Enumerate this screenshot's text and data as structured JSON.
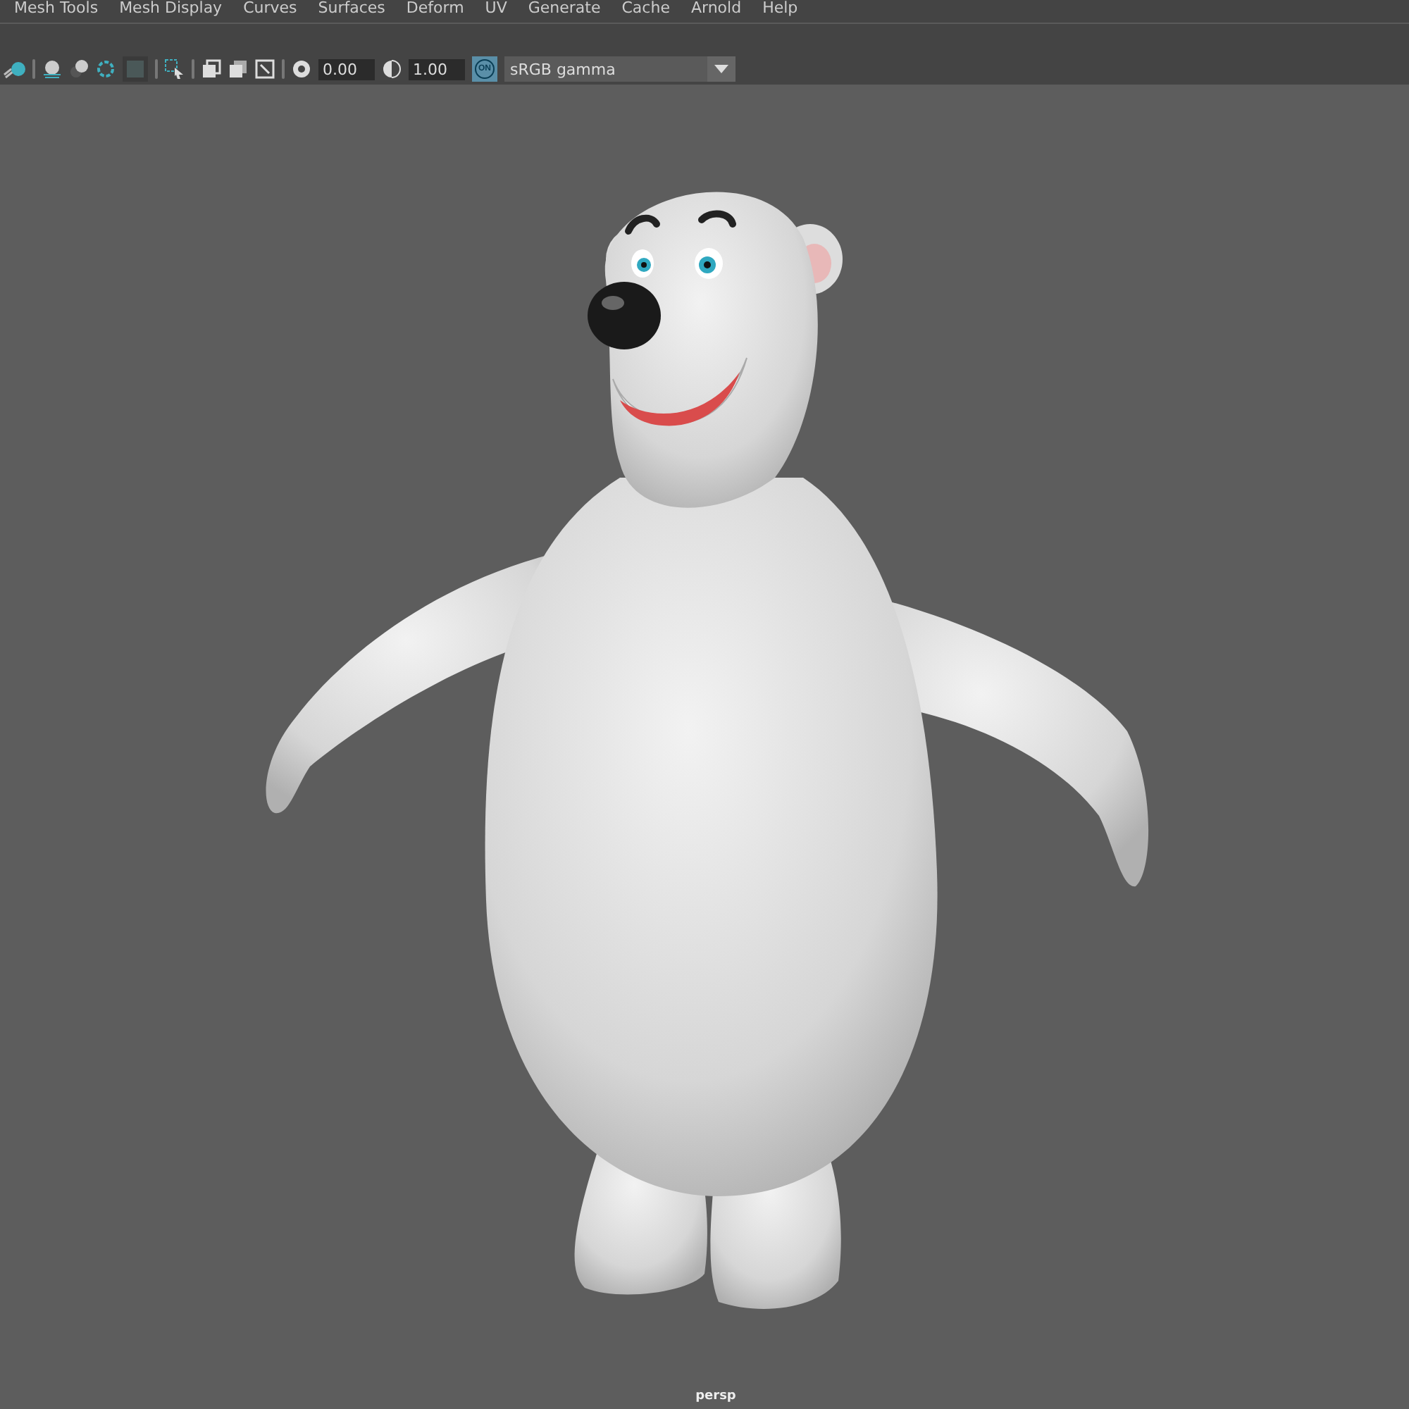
{
  "menu_bar": {
    "items": [
      "Mesh Tools",
      "Mesh Display",
      "Curves",
      "Surfaces",
      "Deform",
      "UV",
      "Generate",
      "Cache",
      "Arnold",
      "Help"
    ]
  },
  "panel_toolbar": {
    "exposure": "0.00",
    "gamma": "1.00",
    "color_management": {
      "label": "ON",
      "on": true
    },
    "view_transform": "sRGB gamma"
  },
  "viewport": {
    "camera": "persp"
  }
}
